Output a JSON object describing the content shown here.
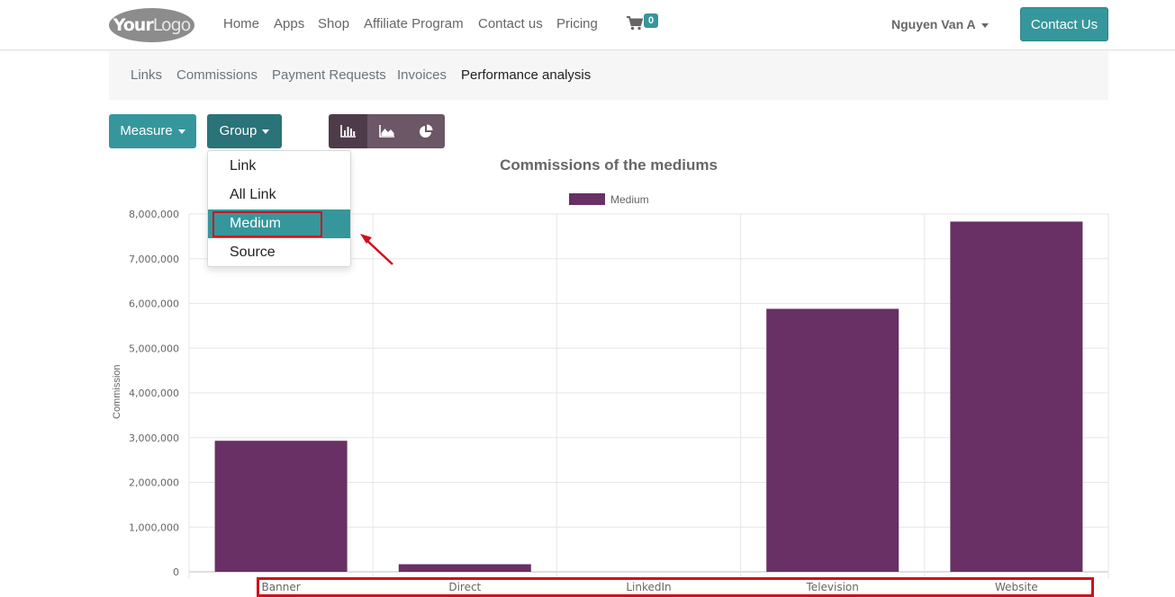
{
  "navbar": {
    "logo_bold": "Your",
    "logo_light": "Logo",
    "items": [
      "Home",
      "Apps",
      "Shop",
      "Affiliate Program",
      "Contact us",
      "Pricing"
    ],
    "cart_icon": "cart-icon",
    "cart_count": "0",
    "user_name": "Nguyen Van A",
    "contact_button": "Contact Us"
  },
  "subnav": {
    "items": [
      "Links",
      "Commissions",
      "Payment Requests",
      "Invoices",
      "Performance analysis"
    ],
    "active": "Performance analysis"
  },
  "toolbar": {
    "measure_label": "Measure",
    "group_label": "Group",
    "view_buttons": [
      "bar-chart-icon",
      "line-chart-icon",
      "pie-chart-icon"
    ],
    "active_view": "bar-chart-icon"
  },
  "group_dropdown": {
    "options": [
      "Link",
      "All Link",
      "Medium",
      "Source"
    ],
    "selected": "Medium"
  },
  "colors": {
    "accent": "#35979c",
    "bar": "#683064",
    "highlight": "#d0101c"
  },
  "chart_data": {
    "type": "bar",
    "title": "Commissions of the mediums",
    "ylabel": "Commission",
    "xlabel": "",
    "categories": [
      "Banner",
      "Direct",
      "LinkedIn",
      "Television",
      "Website"
    ],
    "series": [
      {
        "name": "Medium",
        "values": [
          2930000,
          170000,
          0,
          5880000,
          7830000
        ]
      }
    ],
    "ylim": [
      0,
      8000000
    ],
    "yticks": [
      "0",
      "1,000,000",
      "2,000,000",
      "3,000,000",
      "4,000,000",
      "5,000,000",
      "6,000,000",
      "7,000,000",
      "8,000,000"
    ],
    "grid": true,
    "legend_position": "top"
  }
}
